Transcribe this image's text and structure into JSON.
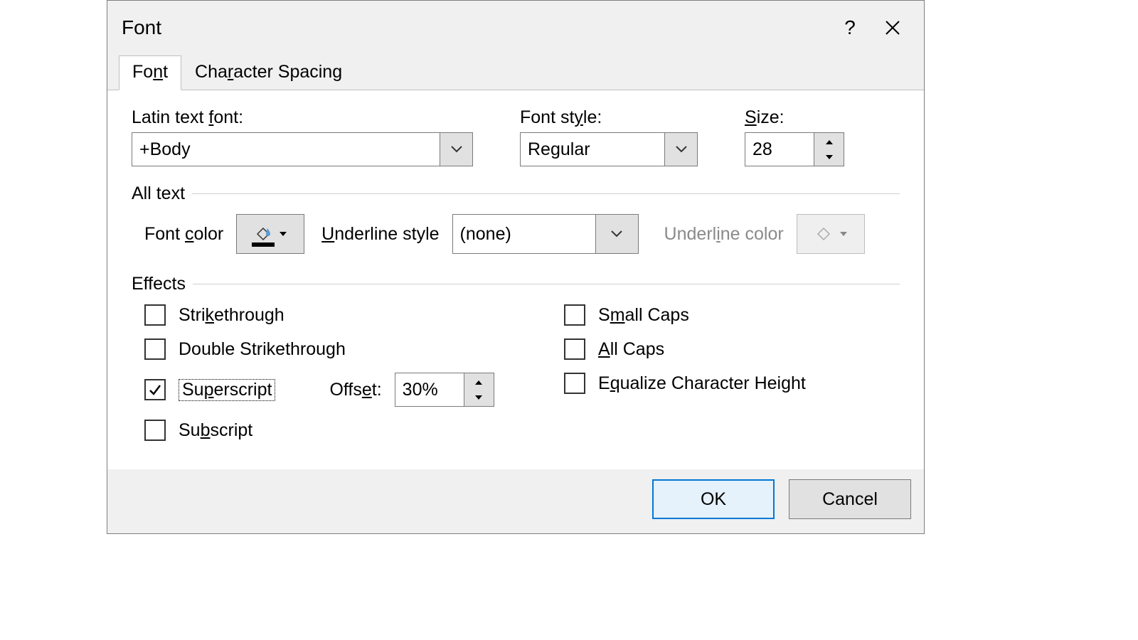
{
  "dialog": {
    "title": "Font"
  },
  "tabs": {
    "font_pre": "Fo",
    "font_ul": "n",
    "font_post": "t",
    "spacing_pre": "Cha",
    "spacing_ul": "r",
    "spacing_post": "acter Spacing"
  },
  "labels": {
    "latin_pre": "Latin text ",
    "latin_ul": "f",
    "latin_post": "ont:",
    "style_pre": "Font st",
    "style_ul": "y",
    "style_post": "le:",
    "size_ul": "S",
    "size_post": "ize:",
    "all_text": "All text",
    "font_color_pre": "Font ",
    "font_color_ul": "c",
    "font_color_post": "olor",
    "ul_style_ul": "U",
    "ul_style_post": "nderline style",
    "ul_color_pre": "Underl",
    "ul_color_ul": "i",
    "ul_color_post": "ne color",
    "effects": "Effects",
    "offset_pre": "Offs",
    "offset_ul": "e",
    "offset_post": "t:"
  },
  "values": {
    "latin_font": "+Body",
    "font_style": "Regular",
    "size": "28",
    "underline_style": "(none)",
    "offset": "30%"
  },
  "effects": {
    "strike_pre": "Stri",
    "strike_ul": "k",
    "strike_post": "ethrough",
    "dstrike": "Double Strikethrough",
    "super_pre": "Su",
    "super_ul": "p",
    "super_post": "erscript",
    "sub_pre": "Su",
    "sub_ul": "b",
    "sub_post": "script",
    "small_pre": "S",
    "small_ul": "m",
    "small_post": "all Caps",
    "all_ul": "A",
    "all_post": "ll Caps",
    "eq_pre": "E",
    "eq_ul": "q",
    "eq_post": "ualize Character Height"
  },
  "buttons": {
    "ok": "OK",
    "cancel": "Cancel"
  }
}
